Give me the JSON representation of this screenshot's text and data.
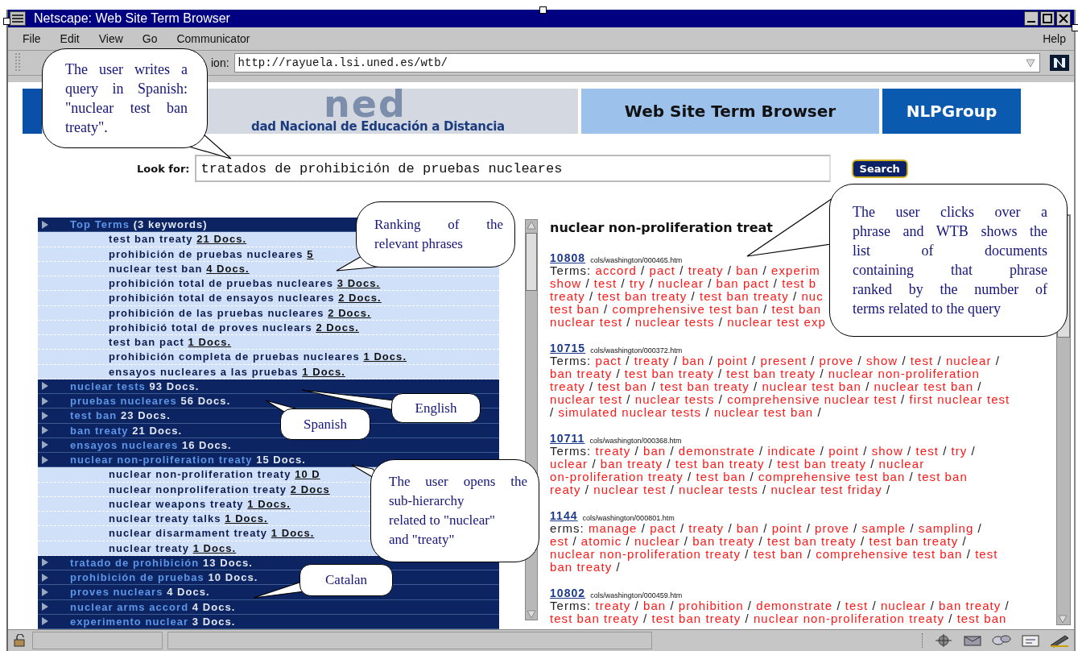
{
  "window": {
    "title": "Netscape: Web Site Term Browser"
  },
  "menu": [
    "File",
    "Edit",
    "View",
    "Go",
    "Communicator"
  ],
  "help_menu": "Help",
  "location": {
    "label": "ion:",
    "url": "http://rayuela.lsi.uned.es/wtb/"
  },
  "banner": {
    "logo_text": "ned",
    "university": "dad Nacional de Educación a Distancia",
    "title": "Web Site Term Browser",
    "group": "NLPGroup"
  },
  "search": {
    "label": "Look for:",
    "value": "tratados de prohibición de pruebas nucleares",
    "button": "Search"
  },
  "tree": [
    {
      "label": "Top Terms",
      "count": "(3 keywords)",
      "children": [
        {
          "label": "test ban treaty",
          "docs": "21 Docs."
        },
        {
          "label": "prohibición de pruebas nucleares",
          "docs": "5"
        },
        {
          "label": "nuclear test ban",
          "docs": "4 Docs."
        },
        {
          "label": "prohibición total de pruebas nucleares",
          "docs": "3 Docs."
        },
        {
          "label": "prohibición total de ensayos nucleares",
          "docs": "2 Docs."
        },
        {
          "label": "prohibición de las pruebas nucleares",
          "docs": "2 Docs."
        },
        {
          "label": "prohibició total de proves nuclears",
          "docs": "2 Docs."
        },
        {
          "label": "test ban pact",
          "docs": "1 Docs."
        },
        {
          "label": "prohibición completa de pruebas nucleares",
          "docs": "1 Docs."
        },
        {
          "label": "ensayos nucleares a las pruebas",
          "docs": "1 Docs."
        }
      ]
    },
    {
      "label": "nuclear tests",
      "count": "93 Docs."
    },
    {
      "label": "pruebas nucleares",
      "count": "56 Docs."
    },
    {
      "label": "test ban",
      "count": "23 Docs."
    },
    {
      "label": "ban treaty",
      "count": "21 Docs."
    },
    {
      "label": "ensayos nucleares",
      "count": "16 Docs."
    },
    {
      "label": "nuclear non-proliferation treaty",
      "count": "15 Docs.",
      "children": [
        {
          "label": "nuclear non-proliferation treaty",
          "docs": "10 D"
        },
        {
          "label": "nuclear nonproliferation treaty",
          "docs": "2 Docs"
        },
        {
          "label": "nuclear weapons treaty",
          "docs": "1 Docs."
        },
        {
          "label": "nuclear treaty talks",
          "docs": "1 Docs."
        },
        {
          "label": "nuclear disarmament treaty",
          "docs": "1 Docs."
        },
        {
          "label": "nuclear treaty",
          "docs": "1 Docs."
        }
      ]
    },
    {
      "label": "tratado de prohibición",
      "count": "13 Docs."
    },
    {
      "label": "prohibición de pruebas",
      "count": "10 Docs."
    },
    {
      "label": "proves nuclears",
      "count": "4 Docs."
    },
    {
      "label": "nuclear arms accord",
      "count": "4 Docs."
    },
    {
      "label": "experimento nuclear",
      "count": "3 Docs."
    }
  ],
  "results": {
    "heading": "nuclear non-proliferation treat",
    "documents": [
      {
        "id": "10808",
        "path": "cols/washington/000465.htm",
        "terms_label": "Terms:",
        "lines": [
          "accord / pact / treaty / ban / experim",
          "show / test / try / nuclear / ban pact / test b",
          "treaty / test ban treaty / test ban treaty / nuc",
          "test ban / comprehensive test ban / test ban",
          "nuclear test / nuclear tests / nuclear test exp"
        ]
      },
      {
        "id": "10715",
        "path": "cols/washington/000372.htm",
        "terms_label": "Terms:",
        "lines": [
          "pact / treaty / ban / point / present / prove / show / test / nuclear /",
          "ban treaty / test ban treaty / test ban treaty / nuclear non-proliferation",
          "treaty / test ban / test ban treaty / nuclear test ban / nuclear test ban /",
          "nuclear test / nuclear tests / comprehensive nuclear test / first nuclear test",
          "/ simulated nuclear tests / nuclear test ban /"
        ]
      },
      {
        "id": "10711",
        "path": "cols/washington/000368.htm",
        "terms_label": "Terms:",
        "lines": [
          "treaty / ban / demonstrate / indicate / point / show / test / try /",
          "uclear / ban treaty / test ban treaty / test ban treaty / nuclear",
          "on-proliferation treaty / test ban / comprehensive test ban / test ban",
          "reaty / nuclear test / nuclear tests / nuclear test friday /"
        ]
      },
      {
        "id": "1144",
        "path": "cols/washington/000801.htm",
        "terms_label": "erms:",
        "lines": [
          "manage / pact / treaty / ban / point / prove / sample / sampling /",
          "est / atomic / nuclear / ban treaty / test ban treaty / test ban treaty /",
          "nuclear non-proliferation treaty / test ban / comprehensive test ban / test",
          "ban treaty /"
        ]
      },
      {
        "id": "10802",
        "path": "cols/washington/000459.htm",
        "terms_label": "Terms:",
        "lines": [
          "treaty / ban / prohibition / demonstrate / test / nuclear / ban treaty /",
          "test ban treaty / test ban treaty / nuclear non-proliferation treaty / test ban"
        ]
      }
    ]
  },
  "callouts": [
    {
      "lines": [
        "The user writes a",
        "query in Spanish:",
        "\"nuclear test ban",
        "treaty\"."
      ]
    },
    {
      "lines": [
        "Ranking of the",
        "relevant phrases"
      ]
    },
    {
      "lines": [
        "English"
      ]
    },
    {
      "lines": [
        "Spanish"
      ]
    },
    {
      "lines": [
        "The user opens the",
        "sub-hierarchy",
        "related to \"nuclear\"",
        "and \"treaty\""
      ]
    },
    {
      "lines": [
        "Catalan"
      ]
    },
    {
      "lines": [
        "The user clicks over a",
        "phrase and WTB shows the",
        "list of documents",
        "containing that phrase",
        "ranked by the number of",
        "terms related to the query"
      ]
    }
  ]
}
